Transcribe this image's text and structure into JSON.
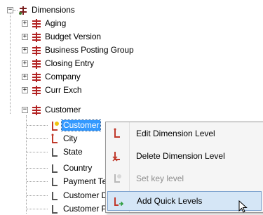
{
  "tree": {
    "root": "Dimensions",
    "dimensions": [
      "Aging",
      "Budget Version",
      "Business Posting Group",
      "Closing Entry",
      "Company",
      "Curr Exch",
      "Customer"
    ],
    "levels": [
      "Customer",
      "City",
      "State",
      "Country",
      "Payment Te",
      "Customer D",
      "Customer P"
    ],
    "expand_collapsed": "+",
    "expand_expanded": "−"
  },
  "context_menu": {
    "items": [
      {
        "label": "Edit Dimension Level",
        "icon": "edit-level-icon",
        "enabled": true
      },
      {
        "label": "Delete Dimension Level",
        "icon": "delete-level-icon",
        "enabled": true
      },
      {
        "label": "Set key level",
        "icon": "key-level-icon",
        "enabled": false
      },
      {
        "label": "Add Quick Levels",
        "icon": "add-quick-levels-icon",
        "enabled": true,
        "hovered": true
      }
    ]
  },
  "colors": {
    "selection": "#3399ff",
    "menu_hover": "#d5e6f6",
    "dimension_icon": "#b22222",
    "level_icon_red": "#c0392b",
    "level_icon_green": "#2e9e3e"
  }
}
